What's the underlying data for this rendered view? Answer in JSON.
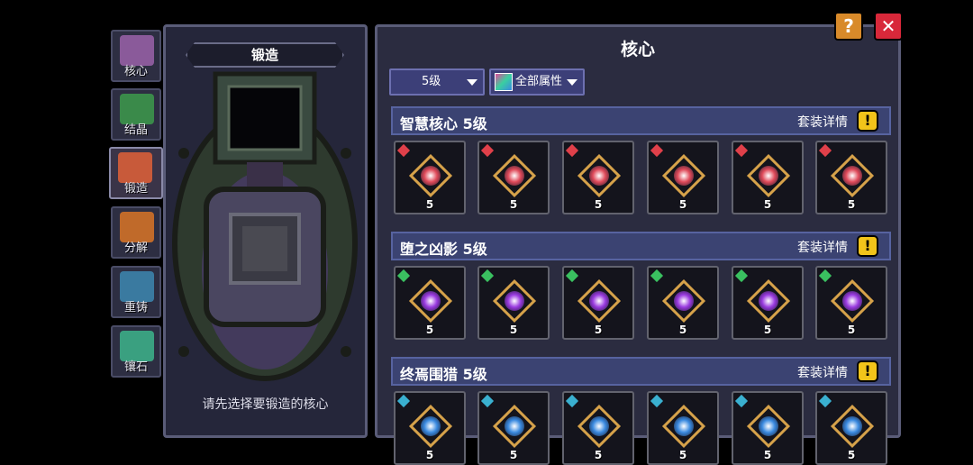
{
  "sidebar": {
    "tabs": [
      {
        "label": "核心",
        "icon": "core-icon",
        "color": "#8a5a9a"
      },
      {
        "label": "结晶",
        "icon": "crystal-icon",
        "color": "#3a8a4a"
      },
      {
        "label": "锻造",
        "icon": "anvil-icon",
        "color": "#c85a3a"
      },
      {
        "label": "分解",
        "icon": "dismantle-icon",
        "color": "#c06a2a"
      },
      {
        "label": "重铸",
        "icon": "recast-icon",
        "color": "#3a7aa0"
      },
      {
        "label": "镶石",
        "icon": "inlay-icon",
        "color": "#3aa080"
      }
    ]
  },
  "forge": {
    "title": "锻造",
    "hint": "请先选择要锻造的核心"
  },
  "main": {
    "title": "核心",
    "level_filter": "5级",
    "attr_filter": "全部属性",
    "help_label": "?",
    "close_label": "✕",
    "sets": [
      {
        "name": "智慧核心 5级",
        "details": "套装详情",
        "warn": "!",
        "gem_color": "#e0404a",
        "core_color": "#e04a5a",
        "slots": [
          "5",
          "5",
          "5",
          "5",
          "5",
          "5"
        ]
      },
      {
        "name": "堕之凶影 5级",
        "details": "套装详情",
        "warn": "!",
        "gem_color": "#3ac060",
        "core_color": "#9a3ae0",
        "slots": [
          "5",
          "5",
          "5",
          "5",
          "5",
          "5"
        ]
      },
      {
        "name": "终焉围猎 5级",
        "details": "套装详情",
        "warn": "!",
        "gem_color": "#3ab0d0",
        "core_color": "#3a8ae0",
        "slots": [
          "5",
          "5",
          "5",
          "5",
          "5",
          "5"
        ]
      }
    ]
  }
}
